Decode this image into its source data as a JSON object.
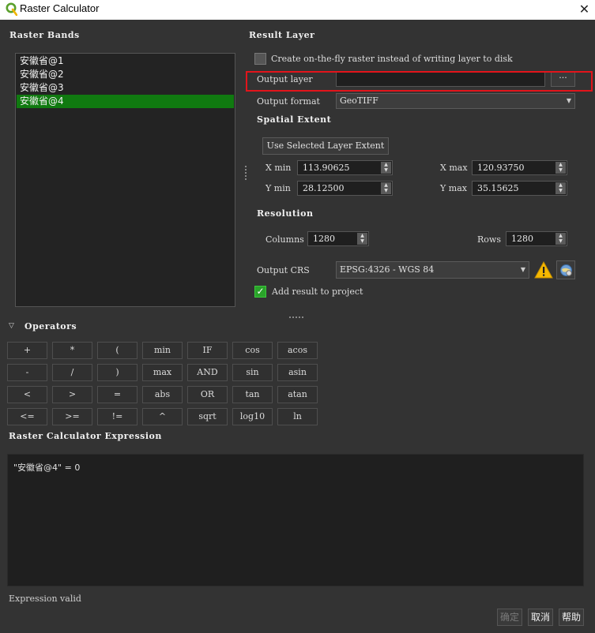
{
  "window": {
    "title": "Raster Calculator",
    "close_glyph": "✕",
    "app_icon": "qgis-icon"
  },
  "raster_bands": {
    "heading": "Raster Bands",
    "items": [
      "安徽省@1",
      "安徽省@2",
      "安徽省@3",
      "安徽省@4"
    ],
    "selected_index": 3
  },
  "result_layer": {
    "heading": "Result Layer",
    "on_the_fly_label": "Create on-the-fly raster instead of writing layer to disk",
    "on_the_fly_checked": false,
    "output_layer_label": "Output layer",
    "output_layer_value": "",
    "browse_label": "···",
    "output_format_label": "Output format",
    "output_format_value": "GeoTIFF"
  },
  "spatial_extent": {
    "heading": "Spatial Extent",
    "use_selected_label": "Use Selected Layer Extent",
    "xmin_label": "X min",
    "xmin_value": "113.90625",
    "xmax_label": "X max",
    "xmax_value": "120.93750",
    "ymin_label": "Y min",
    "ymin_value": "28.12500",
    "ymax_label": "Y max",
    "ymax_value": "35.15625"
  },
  "resolution": {
    "heading": "Resolution",
    "columns_label": "Columns",
    "columns_value": "1280",
    "rows_label": "Rows",
    "rows_value": "1280"
  },
  "crs": {
    "label": "Output CRS",
    "value": "EPSG:4326 - WGS 84",
    "warning_icon": "warning-icon",
    "select_icon": "crs-select-icon"
  },
  "add_to_project": {
    "label": "Add result to project",
    "checked": true
  },
  "operators": {
    "heading": "Operators",
    "rows": [
      [
        "+",
        "*",
        "(",
        "min",
        "IF",
        "cos",
        "acos"
      ],
      [
        "-",
        "/",
        ")",
        "max",
        "AND",
        "sin",
        "asin"
      ],
      [
        "<",
        ">",
        "=",
        "abs",
        "OR",
        "tan",
        "atan"
      ],
      [
        "<=",
        ">=",
        "!=",
        "^",
        "sqrt",
        "log10",
        "ln"
      ]
    ]
  },
  "expression": {
    "heading": "Raster Calculator Expression",
    "value": "\"安徽省@4\" = 0",
    "status": "Expression valid"
  },
  "footer": {
    "ok_label": "确定",
    "cancel_label": "取消",
    "help_label": "帮助"
  },
  "colors": {
    "highlight": "#e3141b",
    "selection": "#107a10",
    "background": "#333333"
  }
}
